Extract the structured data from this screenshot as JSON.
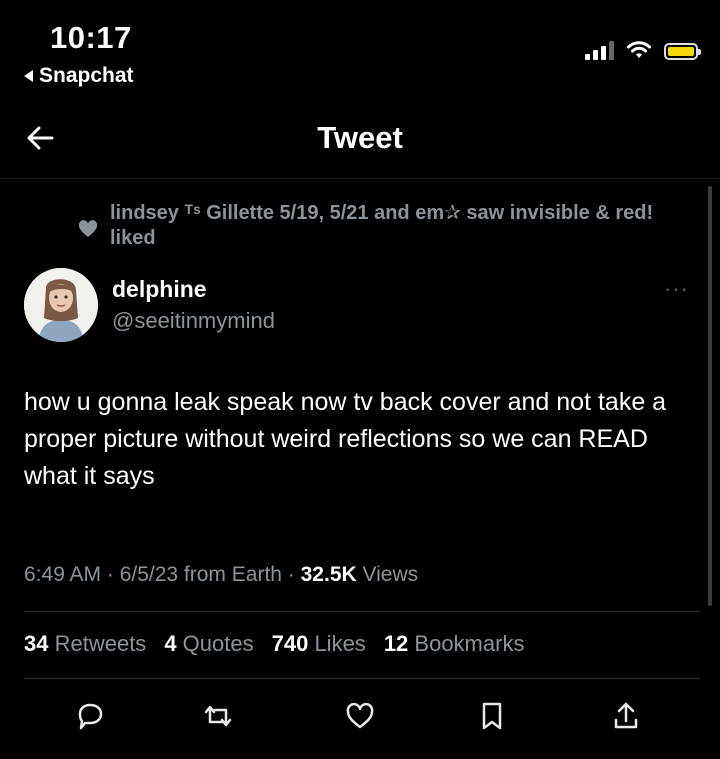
{
  "status_bar": {
    "time": "10:17",
    "back_app": "Snapchat"
  },
  "header": {
    "title": "Tweet"
  },
  "social_context": {
    "text": "lindsey ᵀˢ Gillette 5/19, 5/21 and em✰ saw invisible & red! liked"
  },
  "tweet": {
    "author_name": "delphine",
    "author_handle": "@seeitinmymind",
    "more": "···",
    "text": "how u gonna leak speak now tv back cover and not take a proper picture without weird reflections so we can READ what it says",
    "time": "6:49 AM · 6/5/23 from Earth · ",
    "views_count": "32.5K",
    "views_label": " Views"
  },
  "stats": {
    "retweets_count": "34",
    "retweets_label": " Retweets",
    "quotes_count": "4",
    "quotes_label": " Quotes",
    "likes_count": "740",
    "likes_label": " Likes",
    "bookmarks_count": "12",
    "bookmarks_label": " Bookmarks"
  },
  "colors": {
    "background": "#000000",
    "text_primary": "#ffffff",
    "text_secondary": "#8b949a",
    "battery": "#f5d90a"
  },
  "icons": [
    "back-arrow-icon",
    "signal-icon",
    "wifi-icon",
    "battery-icon",
    "heart-icon",
    "more-icon",
    "reply-icon",
    "retweet-icon",
    "like-icon",
    "bookmark-icon",
    "share-icon"
  ]
}
